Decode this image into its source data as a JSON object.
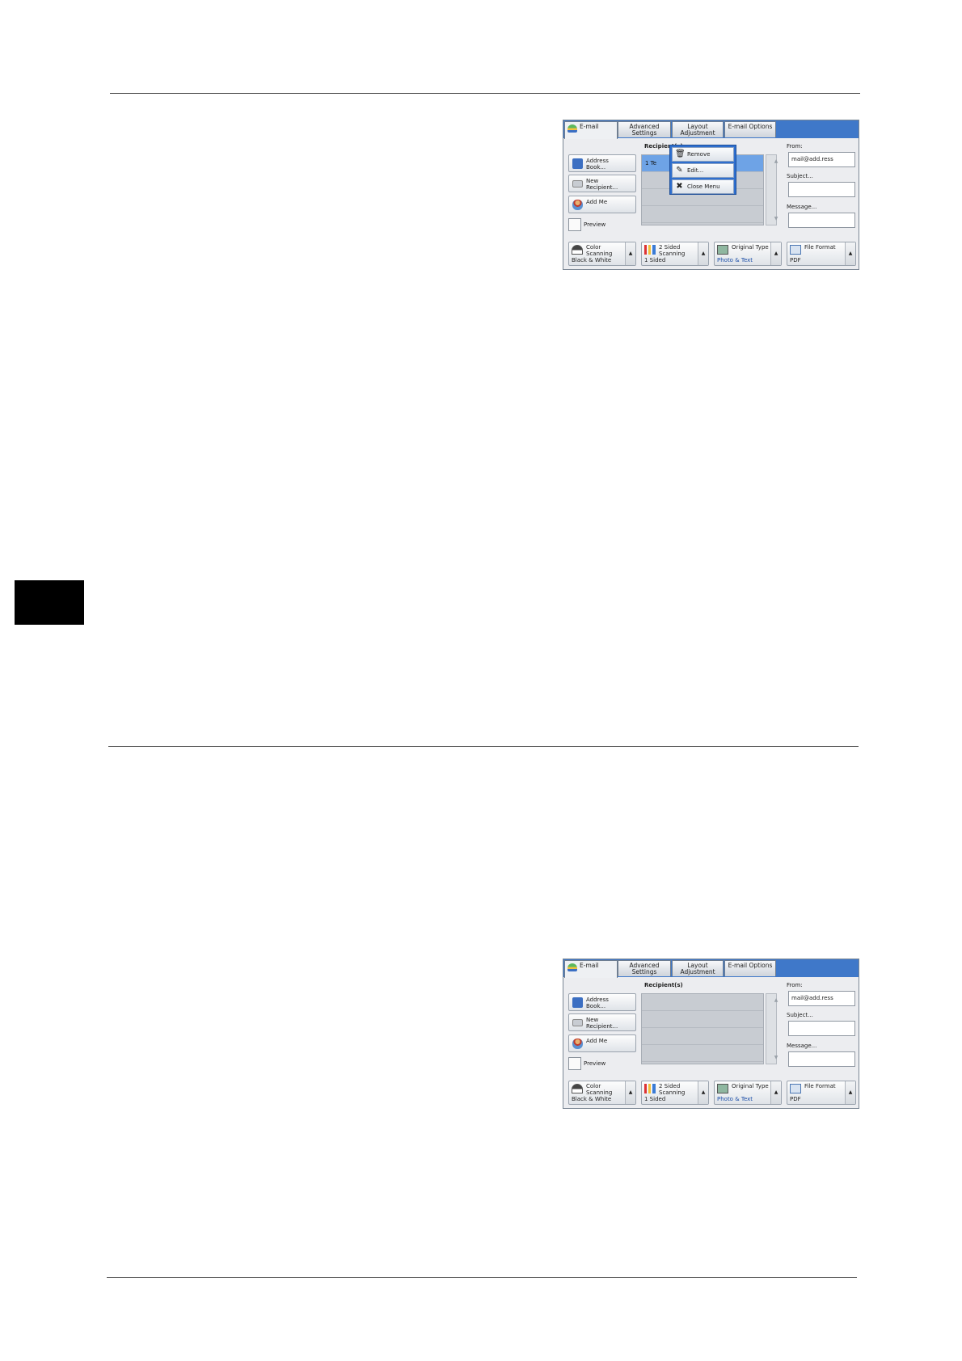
{
  "screens": [
    {
      "tabs": {
        "email": "E-mail",
        "advanced_1": "Advanced",
        "advanced_2": "Settings",
        "layout_1": "Layout",
        "layout_2": "Adjustment",
        "options": "E-mail Options"
      },
      "left_buttons": {
        "address_1": "Address",
        "address_2": "Book...",
        "new_1": "New",
        "new_2": "Recipient...",
        "add_me": "Add Me",
        "preview": "Preview"
      },
      "recipients_label": "Recipient(s)",
      "selected_row_text": "1     Te",
      "from_label": "From:",
      "from_value": "mail@add.ress",
      "subject_label": "Subject...",
      "message_label": "Message...",
      "bottom": {
        "color_1": "Color",
        "color_2": "Scanning",
        "color_value": "Black & White",
        "sided_1": "2 Sided",
        "sided_2": "Scanning",
        "sided_value": "1 Sided",
        "original_1": "Original Type",
        "original_value": "Photo & Text",
        "format_1": "File Format",
        "format_value": "PDF"
      },
      "popup": {
        "remove": "Remove",
        "edit": "Edit...",
        "close": "Close Menu"
      }
    },
    {
      "tabs": {
        "email": "E-mail",
        "advanced_1": "Advanced",
        "advanced_2": "Settings",
        "layout_1": "Layout",
        "layout_2": "Adjustment",
        "options": "E-mail Options"
      },
      "left_buttons": {
        "address_1": "Address",
        "address_2": "Book...",
        "new_1": "New",
        "new_2": "Recipient...",
        "add_me": "Add Me",
        "preview": "Preview"
      },
      "recipients_label": "Recipient(s)",
      "from_label": "From:",
      "from_value": "mail@add.ress",
      "subject_label": "Subject...",
      "message_label": "Message...",
      "bottom": {
        "color_1": "Color",
        "color_2": "Scanning",
        "color_value": "Black & White",
        "sided_1": "2 Sided",
        "sided_2": "Scanning",
        "sided_value": "1 Sided",
        "original_1": "Original Type",
        "original_value": "Photo & Text",
        "format_1": "File Format",
        "format_value": "PDF"
      }
    }
  ],
  "colors": {
    "tab_bar": "#3f78c9",
    "selected_row": "#6ea3e6",
    "popup": "#2e6fcf",
    "side_tab": "#000000"
  },
  "icons": [
    "email-icon",
    "address-book-icon",
    "keyboard-icon",
    "person-icon",
    "trash-icon",
    "edit-icon",
    "close-icon",
    "color-icon",
    "two-sided-icon",
    "original-type-icon",
    "file-format-icon"
  ]
}
